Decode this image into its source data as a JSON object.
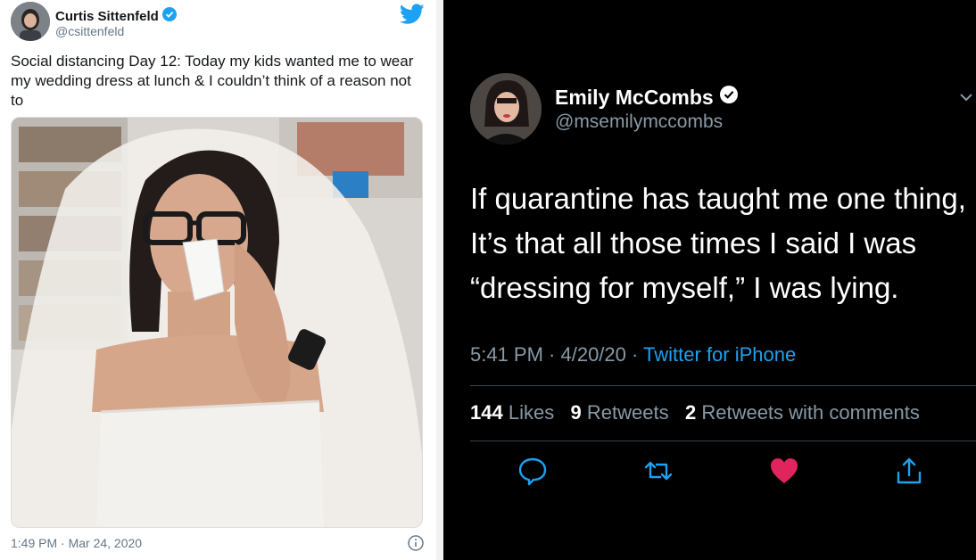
{
  "left_tweet": {
    "name": "Curtis Sittenfeld",
    "handle": "@csittenfeld",
    "text": "Social distancing Day 12: Today my kids wanted me to wear my wedding dress at lunch & I couldn’t think of a reason not to",
    "timestamp": "1:49 PM · Mar 24, 2020",
    "icons": [
      "verified-badge-icon",
      "twitter-bird-icon",
      "info-icon"
    ]
  },
  "right_tweet": {
    "name": "Emily McCombs",
    "handle": "@msemilymccombs",
    "text_lines": [
      "If quarantine has taught me one thing,",
      "It’s that all those times I said I was",
      "“dressing for myself,” I was lying."
    ],
    "time": "5:41 PM · 4/20/20 · ",
    "source": "Twitter for iPhone",
    "likes_count": "144",
    "likes_label": " Likes",
    "retweets_count": "9",
    "retweets_label": " Retweets",
    "quotes_count": "2",
    "quotes_label": " Retweets with comments",
    "icons": [
      "verified-badge-icon",
      "chevron-down-icon",
      "reply-icon",
      "retweet-icon",
      "heart-icon",
      "share-icon"
    ]
  },
  "colors": {
    "twitter_blue": "#1da1f2",
    "like_red": "#e0245e",
    "muted_gray": "#8899a6"
  }
}
